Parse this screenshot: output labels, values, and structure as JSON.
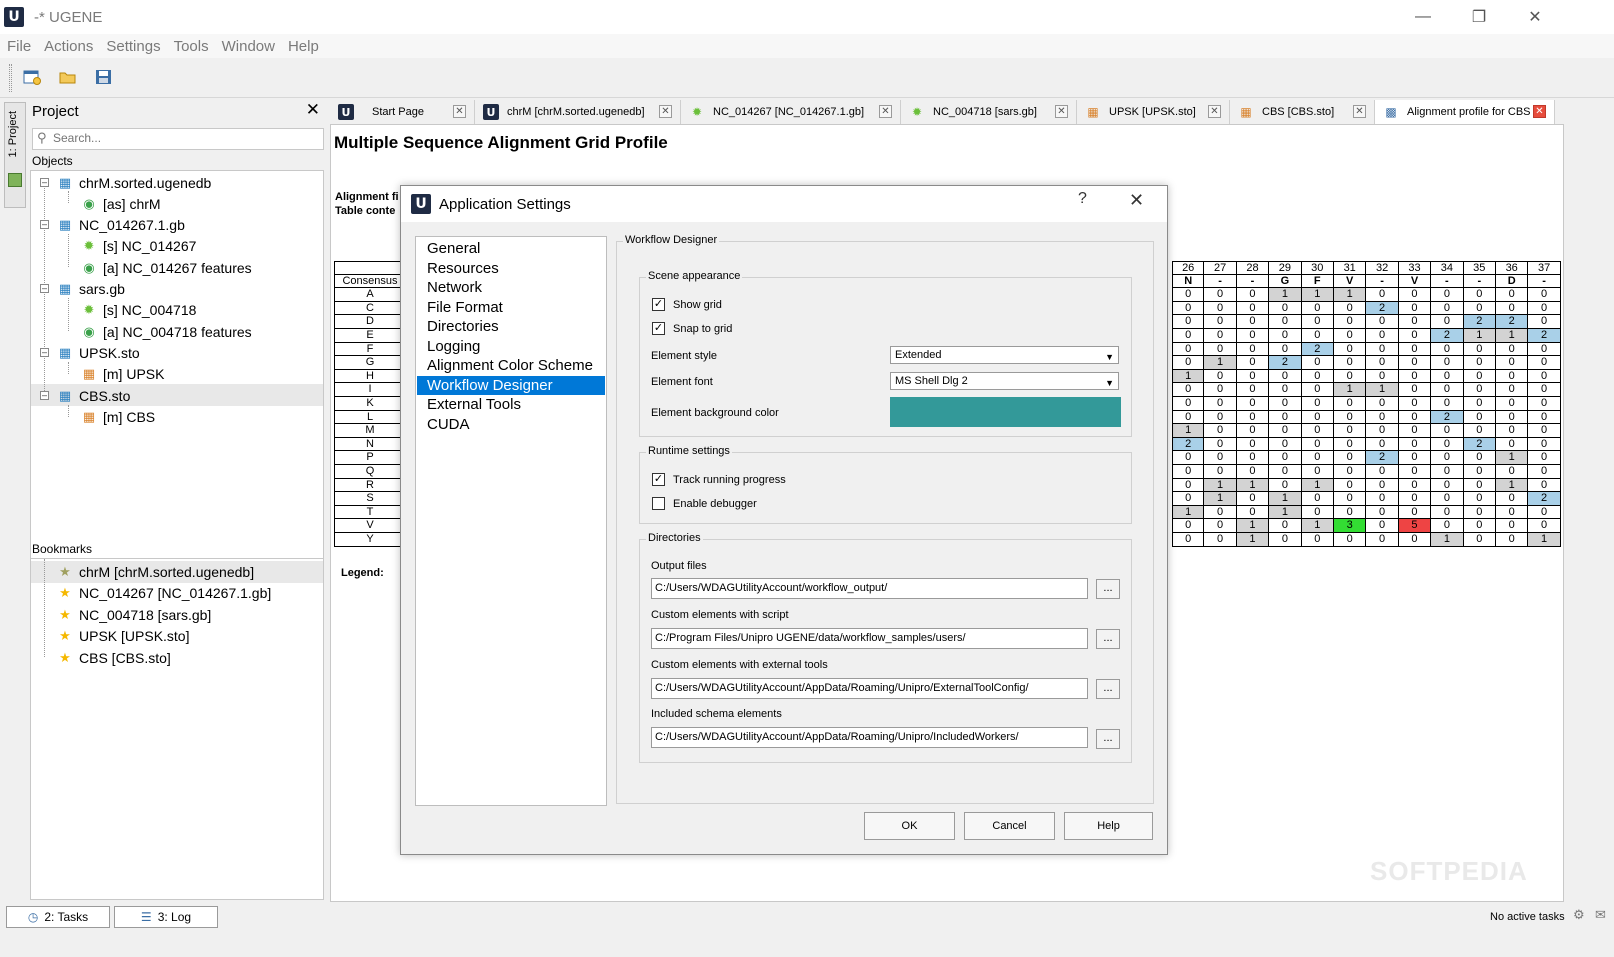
{
  "window": {
    "title": "-* UGENE",
    "logo_letter": "U"
  },
  "menu": [
    "File",
    "Actions",
    "Settings",
    "Tools",
    "Window",
    "Help"
  ],
  "left_strip": {
    "label": "1: Project"
  },
  "project": {
    "title": "Project",
    "search_placeholder": "Search...",
    "objects_label": "Objects",
    "tree": [
      {
        "label": "chrM.sorted.ugenedb"
      },
      {
        "label": "[as] chrM"
      },
      {
        "label": "NC_014267.1.gb"
      },
      {
        "label": "[s] NC_014267"
      },
      {
        "label": "[a] NC_014267 features"
      },
      {
        "label": "sars.gb"
      },
      {
        "label": "[s] NC_004718"
      },
      {
        "label": "[a] NC_004718 features"
      },
      {
        "label": "UPSK.sto"
      },
      {
        "label": "[m] UPSK"
      },
      {
        "label": "CBS.sto"
      },
      {
        "label": "[m] CBS"
      }
    ],
    "bookmarks_label": "Bookmarks",
    "bookmarks": [
      {
        "label": "chrM [chrM.sorted.ugenedb]"
      },
      {
        "label": "NC_014267 [NC_014267.1.gb]"
      },
      {
        "label": "NC_004718 [sars.gb]"
      },
      {
        "label": "UPSK [UPSK.sto]"
      },
      {
        "label": "CBS [CBS.sto]"
      }
    ]
  },
  "tabs": [
    {
      "label": "Start Page"
    },
    {
      "label": "chrM [chrM.sorted.ugenedb]"
    },
    {
      "label": "NC_014267 [NC_014267.1.gb]"
    },
    {
      "label": "NC_004718 [sars.gb]"
    },
    {
      "label": "UPSK [UPSK.sto]"
    },
    {
      "label": "CBS [CBS.sto]"
    },
    {
      "label": "Alignment profile for CBS"
    }
  ],
  "report": {
    "title": "Multiple Sequence Alignment Grid Profile",
    "alignment_label": "Alignment fi",
    "table_label": "Table conte",
    "legend_label": "Legend:",
    "consensus_label": "Consensus",
    "row_labels": [
      "A",
      "C",
      "D",
      "E",
      "F",
      "G",
      "H",
      "I",
      "K",
      "L",
      "M",
      "N",
      "P",
      "Q",
      "R",
      "S",
      "T",
      "V",
      "Y"
    ],
    "col_numbers": [
      "26",
      "27",
      "28",
      "29",
      "30",
      "31",
      "32",
      "33",
      "34",
      "35",
      "36",
      "37"
    ],
    "consensus": [
      "N",
      "-",
      "-",
      "G",
      "F",
      "V",
      "-",
      "V",
      "-",
      "-",
      "D",
      "-"
    ],
    "grid": [
      [
        "0",
        "0",
        "0",
        "1",
        "1",
        "1",
        "0",
        "0",
        "0",
        "0",
        "0",
        "0"
      ],
      [
        "0",
        "0",
        "0",
        "0",
        "0",
        "0",
        "2",
        "0",
        "0",
        "0",
        "0",
        "0"
      ],
      [
        "0",
        "0",
        "0",
        "0",
        "0",
        "0",
        "0",
        "0",
        "0",
        "2",
        "2",
        "0"
      ],
      [
        "0",
        "0",
        "0",
        "0",
        "0",
        "0",
        "0",
        "0",
        "2",
        "1",
        "1",
        "2"
      ],
      [
        "0",
        "0",
        "0",
        "0",
        "2",
        "0",
        "0",
        "0",
        "0",
        "0",
        "0",
        "0"
      ],
      [
        "0",
        "1",
        "0",
        "2",
        "0",
        "0",
        "0",
        "0",
        "0",
        "0",
        "0",
        "0"
      ],
      [
        "1",
        "0",
        "0",
        "0",
        "0",
        "0",
        "0",
        "0",
        "0",
        "0",
        "0",
        "0"
      ],
      [
        "0",
        "0",
        "0",
        "0",
        "0",
        "1",
        "1",
        "0",
        "0",
        "0",
        "0",
        "0"
      ],
      [
        "0",
        "0",
        "0",
        "0",
        "0",
        "0",
        "0",
        "0",
        "0",
        "0",
        "0",
        "0"
      ],
      [
        "0",
        "0",
        "0",
        "0",
        "0",
        "0",
        "0",
        "0",
        "2",
        "0",
        "0",
        "0"
      ],
      [
        "1",
        "0",
        "0",
        "0",
        "0",
        "0",
        "0",
        "0",
        "0",
        "0",
        "0",
        "0"
      ],
      [
        "2",
        "0",
        "0",
        "0",
        "0",
        "0",
        "0",
        "0",
        "0",
        "2",
        "0",
        "0"
      ],
      [
        "0",
        "0",
        "0",
        "0",
        "0",
        "0",
        "2",
        "0",
        "0",
        "0",
        "1",
        "0"
      ],
      [
        "0",
        "0",
        "0",
        "0",
        "0",
        "0",
        "0",
        "0",
        "0",
        "0",
        "0",
        "0"
      ],
      [
        "0",
        "1",
        "1",
        "0",
        "1",
        "0",
        "0",
        "0",
        "0",
        "0",
        "1",
        "0"
      ],
      [
        "0",
        "1",
        "0",
        "1",
        "0",
        "0",
        "0",
        "0",
        "0",
        "0",
        "0",
        "2"
      ],
      [
        "1",
        "0",
        "0",
        "1",
        "0",
        "0",
        "0",
        "0",
        "0",
        "0",
        "0",
        "0"
      ],
      [
        "0",
        "0",
        "1",
        "0",
        "1",
        "3",
        "0",
        "5",
        "0",
        "0",
        "0",
        "0"
      ],
      [
        "0",
        "0",
        "1",
        "0",
        "0",
        "0",
        "0",
        "0",
        "1",
        "0",
        "0",
        "1"
      ]
    ],
    "cell_colors": {
      "gray": "#d3d3d3",
      "blue": "#a9d0e8",
      "green": "#33dd33",
      "red": "#ee4444"
    }
  },
  "dialog": {
    "title": "Application Settings",
    "help_glyph": "?",
    "categories": [
      "General",
      "Resources",
      "Network",
      "File Format",
      "Directories",
      "Logging",
      "Alignment Color Scheme",
      "Workflow Designer",
      "External Tools",
      "CUDA"
    ],
    "selected_category": "Workflow Designer",
    "page_title": "Workflow Designer",
    "scene": {
      "title": "Scene appearance",
      "show_grid": "Show grid",
      "snap_to_grid": "Snap to grid",
      "element_style_label": "Element style",
      "element_style_value": "Extended",
      "element_font_label": "Element font",
      "element_font_value": "MS Shell Dlg 2",
      "bg_color_label": "Element background color",
      "bg_color": "#339999"
    },
    "runtime": {
      "title": "Runtime settings",
      "track_progress": "Track running progress",
      "enable_debugger": "Enable debugger"
    },
    "directories": {
      "title": "Directories",
      "output_label": "Output files",
      "output_value": "C:/Users/WDAGUtilityAccount/workflow_output/",
      "script_label": "Custom elements with script",
      "script_value": "C:/Program Files/Unipro UGENE/data/workflow_samples/users/",
      "ext_label": "Custom elements with external tools",
      "ext_value": "C:/Users/WDAGUtilityAccount/AppData/Roaming/Unipro/ExternalToolConfig/",
      "schema_label": "Included schema elements",
      "schema_value": "C:/Users/WDAGUtilityAccount/AppData/Roaming/Unipro/IncludedWorkers/",
      "browse": "..."
    },
    "buttons": {
      "ok": "OK",
      "cancel": "Cancel",
      "help": "Help"
    }
  },
  "statusbar": {
    "tasks": "2: Tasks",
    "log": "3: Log",
    "status": "No active tasks"
  },
  "watermark": "SOFTPEDIA"
}
